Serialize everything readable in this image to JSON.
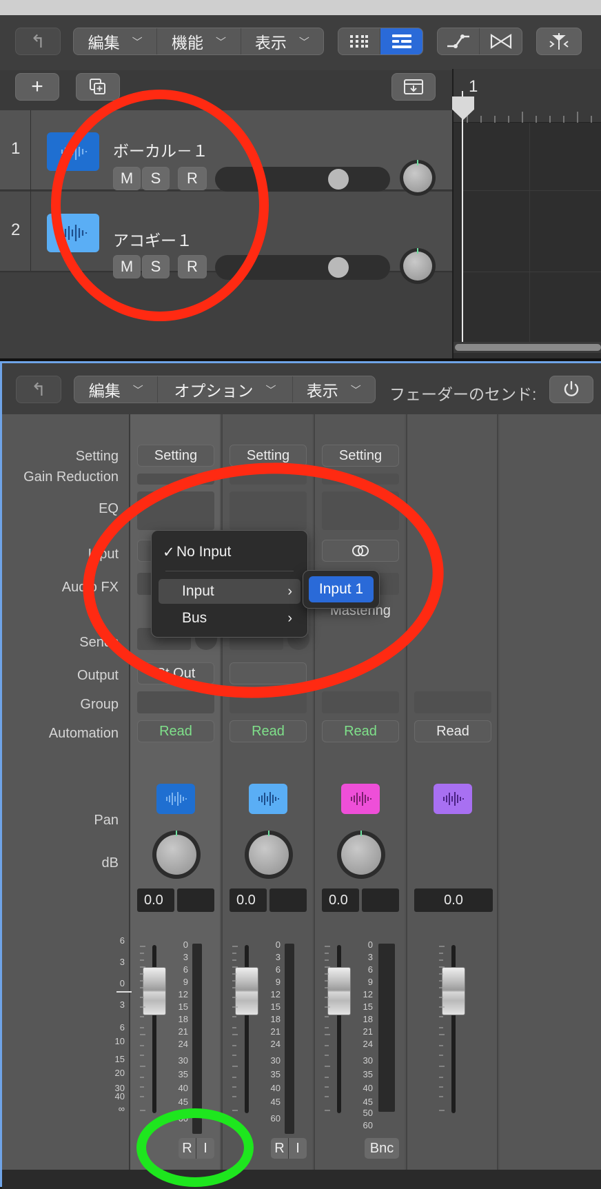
{
  "tracks_toolbar": {
    "edit": "編集",
    "functions": "機能",
    "view": "表示"
  },
  "tracks": [
    {
      "number": "1",
      "name": "ボーカル－１",
      "mute": "M",
      "solo": "S",
      "record": "R",
      "icon_color": "#1f6fd1"
    },
    {
      "number": "2",
      "name": "アコギー１",
      "mute": "M",
      "solo": "S",
      "record": "R",
      "icon_color": "#5aaef5"
    }
  ],
  "ruler": {
    "bar": "1"
  },
  "mixer_toolbar": {
    "edit": "編集",
    "options": "オプション",
    "view": "表示",
    "sends_on_faders": "フェーダーのセンド:"
  },
  "row_labels": {
    "setting": "Setting",
    "gain_reduction": "Gain Reduction",
    "eq": "EQ",
    "input": "Input",
    "audio_fx": "Audio FX",
    "sends": "Sends",
    "output": "Output",
    "group": "Group",
    "automation": "Automation",
    "pan": "Pan",
    "db": "dB"
  },
  "channels": [
    {
      "setting": "Setting",
      "output": "St Out",
      "automation": "Read",
      "db": "0.0",
      "icon_color": "#1f6fd1",
      "buttons": [
        "R",
        "I"
      ]
    },
    {
      "setting": "Setting",
      "output": "",
      "automation": "Read",
      "db": "0.0",
      "icon_color": "#5aaef5",
      "buttons": [
        "R",
        "I"
      ]
    },
    {
      "setting": "Setting",
      "output": "",
      "automation": "Read",
      "db": "0.0",
      "icon_color": "#ee4fd8",
      "buttons": [
        "Bnc"
      ],
      "audio_fx": "Mastering"
    },
    {
      "setting": "",
      "output": "",
      "automation": "Read",
      "db": "0.0",
      "icon_color": "#a870f2",
      "buttons": []
    }
  ],
  "input_menu": {
    "no_input": "No Input",
    "checkmark": "✓",
    "input": "Input",
    "bus": "Bus",
    "submenu_item": "Input 1"
  },
  "fader_scale": [
    "6",
    "3",
    "0",
    "3",
    "6",
    "10",
    "15",
    "20",
    "30",
    "40",
    "∞"
  ],
  "meter_scale": [
    "0",
    "3",
    "6",
    "9",
    "12",
    "15",
    "18",
    "21",
    "24",
    "30",
    "35",
    "40",
    "45",
    "50",
    "60"
  ],
  "colors": {
    "read_green": "#7fe08a",
    "selected_blue": "#2a6ad8",
    "annotation_red": "#ff2a12",
    "annotation_green": "#1ee61e"
  }
}
